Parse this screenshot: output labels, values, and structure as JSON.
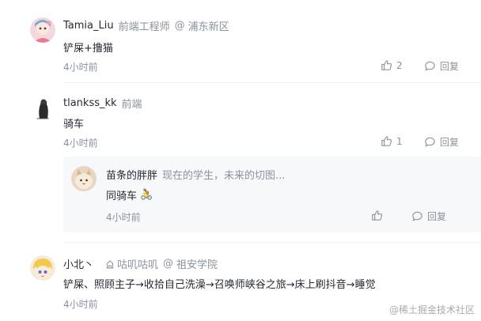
{
  "comments": [
    {
      "username": "Tamia_Liu",
      "job": "前端工程师",
      "at": "@",
      "company": "浦东新区",
      "content": "铲屎+撸猫",
      "time": "4小时前",
      "likes": "2",
      "reply_label": "回复"
    },
    {
      "username": "tlankss_kk",
      "job": "前端",
      "content": "骑车",
      "time": "4小时前",
      "likes": "1",
      "reply_label": "回复",
      "replies": [
        {
          "username": "苗条的胖胖",
          "job": "现在的学生，未来的切图...",
          "content": "同骑车",
          "content_emoji": "🚴",
          "time": "4小时前",
          "reply_label": "回复"
        }
      ]
    },
    {
      "username": "小北丶",
      "company_badge": "咕叽咕叽",
      "at": "@",
      "company": "祖安学院",
      "content": "铲屎、照顾主子→收拾自己洗澡→召唤师峡谷之旅→床上刷抖音→睡觉",
      "time": "4小时前"
    }
  ],
  "watermark": "@稀土掘金技术社区",
  "colors": {
    "text": "#252933",
    "muted": "#8a919f",
    "reply_bg": "#f7f8fa",
    "divider": "#eef0f3"
  }
}
